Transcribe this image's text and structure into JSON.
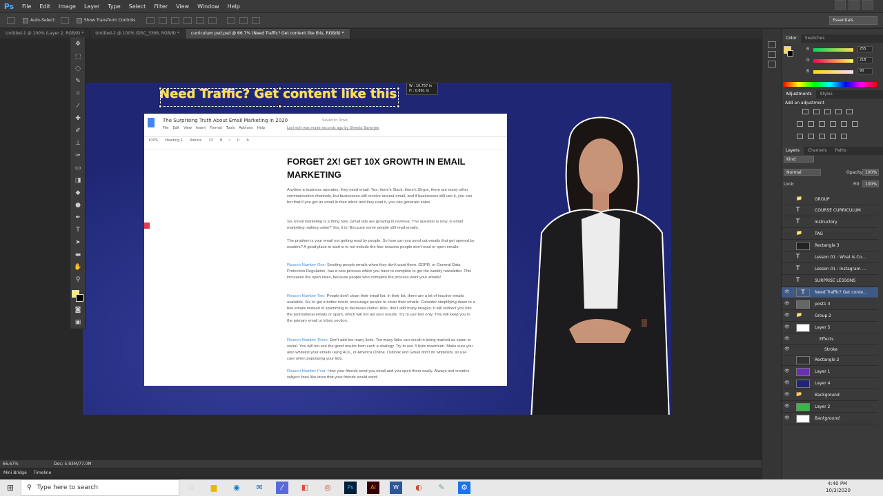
{
  "app": {
    "logo": "Ps",
    "menu": [
      "File",
      "Edit",
      "Image",
      "Layer",
      "Type",
      "Select",
      "Filter",
      "View",
      "Window",
      "Help"
    ],
    "workspace": "Essentials"
  },
  "options_bar": {
    "auto_select": "Auto-Select:",
    "show_transform": "Show Transform Controls"
  },
  "tabs": [
    {
      "label": "Untitled-1 @ 100% (Layer 2, RGB/8) *"
    },
    {
      "label": "Untitled-2 @ 100% (DSC_3366, RGB/8) *"
    },
    {
      "label": "curriculum psd.psd @ 66.7% (Need Traffic? Get content like this, RGB/8) *"
    }
  ],
  "canvas": {
    "headline": "Need Traffic? Get content like this",
    "dimension_tip": {
      "w": "W : 10.757 in",
      "h": "H : 0.861 in"
    },
    "doc": {
      "title": "The Surprising Truth About Email Marketing in 2020",
      "saved": "Saved to Drive",
      "menus": [
        "File",
        "Edit",
        "View",
        "Insert",
        "Format",
        "Tools",
        "Add-ons",
        "Help"
      ],
      "last_edit": "Last edit was made seconds ago by Shweta Banerjee",
      "toolbar": [
        "100%",
        "Heading 1",
        "Roboto",
        "23",
        "B",
        "I",
        "U",
        "A"
      ],
      "heading": "FORGET 2X! GET 10X GROWTH IN EMAIL MARKETING",
      "paragraphs": [
        {
          "lead": "",
          "text": "Anytime a business operates, they need email. Yes, there's Slack, there's Skype, there are many other communication channels, but businesses still revolve around email, and if businesses still use it, you can bet that if you get an email in their inbox and they read it, you can generate sales."
        },
        {
          "lead": "",
          "text": "So, email marketing is a thing now. Gmail ads are growing in revenue. The question is now, is email marketing making value? Yes, it is! Because some people still read emails."
        },
        {
          "lead": "",
          "text": "The problem is your email not getting read by people. So how can you send out emails that get opened by readers? A good place to start is to not include the four reasons people don't read or open emails:"
        },
        {
          "lead": "Reason Number One:",
          "text": " Sending people emails when they don't want them. GDPR, or General Data Protection Regulation, has a new process which you have to complete to get the weekly newsletter. This increases the open rates, because people who complete the process want your emails!"
        },
        {
          "lead": "Reason Number Two:",
          "text": " People don't clean their email list. In their list, there are a lot of inactive emails available. So, to get a better result, encourage people to clean their emails. Consider simplifying down to a few emails instead of spamming to decrease clutter. Also, don't add many images. It will redirect you into the promotional emails or spam, which will not aid your results. Try to use text only. This will keep you in the primary email or inbox section."
        },
        {
          "lead": "Reason Number Three:",
          "text": " Don't add too many links. Too many links can result in being marked as spam or social. You will not see the good results from such a strategy. Try to use 3 links maximum. Make sure you also whitelist your emails using AOL, or America Online. Outlook and Gmail don't do whitelists, so use care when populating your lists."
        },
        {
          "lead": "Reason Number Four:",
          "text": " How your friends send you email and you open them easily. Always test creative subject lines like ones that your friends would send."
        }
      ]
    }
  },
  "color_panel": {
    "tabs": [
      "Color",
      "Swatches"
    ],
    "r": "255",
    "g": "218",
    "b": "90",
    "r_label": "R",
    "g_label": "G",
    "b_label": "B",
    "fg": "#ffda5a"
  },
  "adjustments": {
    "tabs": [
      "Adjustments",
      "Styles"
    ],
    "title": "Add an adjustment"
  },
  "layers_panel": {
    "tabs": [
      "Layers",
      "Channels",
      "Paths"
    ],
    "kind": "Kind",
    "blend": "Normal",
    "opacity_label": "Opacity:",
    "opacity": "100%",
    "lock_label": "Lock:",
    "fill_label": "Fill:",
    "fill": "100%",
    "layers": [
      {
        "name": "GROUP",
        "visible": false,
        "kind": "folder",
        "selected": false
      },
      {
        "name": "COURSE CURRICULUM",
        "visible": false,
        "kind": "text",
        "selected": false
      },
      {
        "name": "Instructory",
        "visible": false,
        "kind": "text",
        "selected": false
      },
      {
        "name": "TAG",
        "visible": false,
        "kind": "folder",
        "selected": false
      },
      {
        "name": "Rectangle 3",
        "visible": false,
        "kind": "shape",
        "selected": false
      },
      {
        "name": "Lesson 01 : What is Co...",
        "visible": false,
        "kind": "text",
        "selected": false
      },
      {
        "name": "Lesson 01 : Instagram ...",
        "visible": false,
        "kind": "text",
        "selected": false
      },
      {
        "name": "SURPRISE LESSONS",
        "visible": false,
        "kind": "text",
        "selected": false
      },
      {
        "name": "Need Traffic? Get conte...",
        "visible": true,
        "kind": "text",
        "selected": true
      },
      {
        "name": "post1 3",
        "visible": true,
        "kind": "image",
        "selected": false
      },
      {
        "name": "Group 2",
        "visible": true,
        "kind": "folder",
        "selected": false
      },
      {
        "name": "Layer 5",
        "visible": true,
        "kind": "image-white",
        "selected": false
      },
      {
        "name": "Effects",
        "visible": true,
        "kind": "fx",
        "selected": false
      },
      {
        "name": "Stroke",
        "visible": true,
        "kind": "fx",
        "selected": false
      },
      {
        "name": "Rectangle 2",
        "visible": false,
        "kind": "shape",
        "selected": false
      },
      {
        "name": "Layer 1",
        "visible": true,
        "kind": "purple",
        "selected": false
      },
      {
        "name": "Layer 4",
        "visible": true,
        "kind": "navy",
        "selected": false
      },
      {
        "name": "Background",
        "visible": true,
        "kind": "folder",
        "selected": false
      },
      {
        "name": "Layer 2",
        "visible": true,
        "kind": "green",
        "selected": false
      },
      {
        "name": "Background",
        "visible": true,
        "kind": "white",
        "selected": false
      }
    ]
  },
  "status": {
    "zoom": "66.67%",
    "doc_size": "Doc: 5.93M/77.0M"
  },
  "bottom_tabs": [
    "Mini Bridge",
    "Timeline"
  ],
  "taskbar": {
    "search_placeholder": "Type here to search",
    "time": "4:40 PM",
    "date": "10/3/2020"
  },
  "colors": {
    "canvas_bg": "#1f2775",
    "headline": "#ffe04a",
    "selected_layer": "#3f5a84"
  }
}
